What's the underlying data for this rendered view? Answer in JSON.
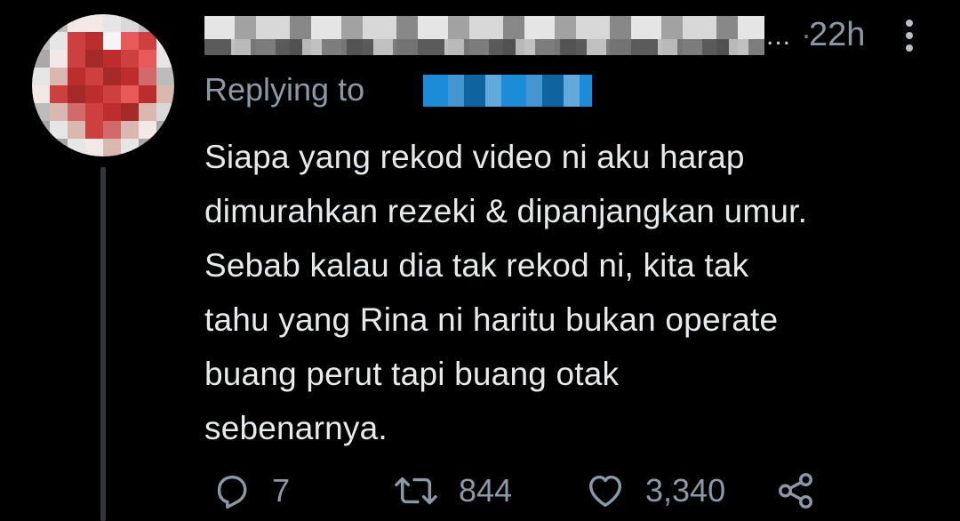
{
  "tweet": {
    "author_name_blurred": true,
    "ellipsis": "...",
    "separator": "·",
    "time": "22h",
    "reply_prefix": "Replying to",
    "text_lines": [
      "Siapa yang rekod video ni aku harap",
      "dimurahkan rezeki & dipanjangkan umur.",
      "Sebab kalau dia tak rekod ni, kita tak",
      "tahu yang Rina ni haritu bukan operate",
      "buang perut tapi buang otak",
      "sebenarnya."
    ]
  },
  "actions": {
    "reply_icon": "speech-bubble-icon",
    "reply_count": "7",
    "retweet_icon": "retweet-icon",
    "retweet_count": "844",
    "like_icon": "heart-icon",
    "like_count": "3,340",
    "share_icon": "share-icon"
  },
  "colors": {
    "background": "#000000",
    "text": "#e7e9ea",
    "muted": "#8b98a5",
    "link": "#1d9bf0"
  }
}
